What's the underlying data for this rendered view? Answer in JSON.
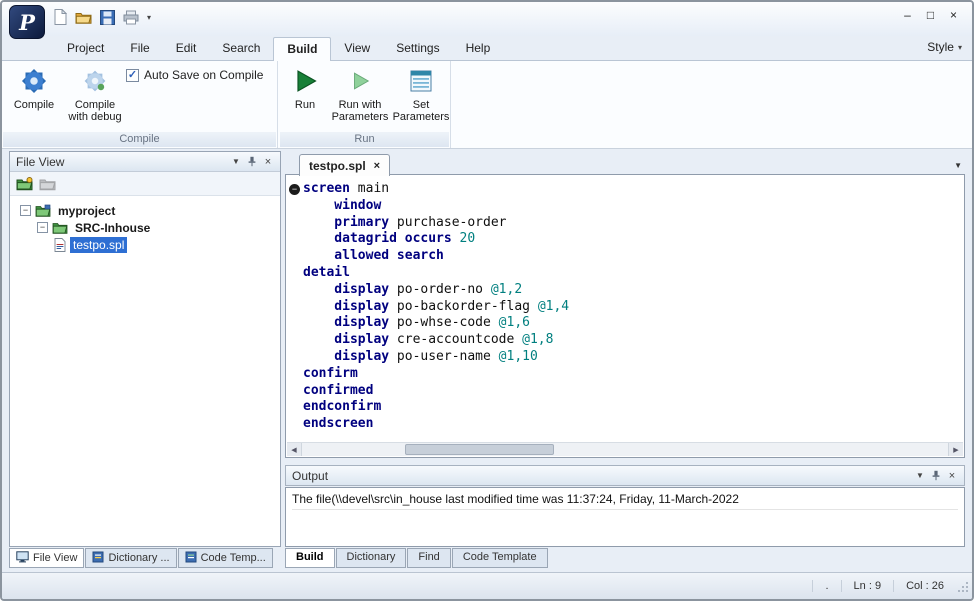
{
  "icons": {
    "chevron_down": "▼",
    "chevron_small": "▾",
    "close": "×",
    "check": "✓",
    "minus": "−",
    "scroll_left": "◀",
    "scroll_right": "▶",
    "logo_letter": "P"
  },
  "titlebar": {
    "window_buttons": {
      "minimize": "–",
      "maximize": "□",
      "close": "×"
    }
  },
  "menu": {
    "tabs": [
      "Project",
      "File",
      "Edit",
      "Search",
      "Build",
      "View",
      "Settings",
      "Help"
    ],
    "active": "Build",
    "style_label": "Style"
  },
  "ribbon": {
    "compile_group": {
      "label": "Compile",
      "auto_save_checkbox": {
        "label": "Auto Save on Compile",
        "checked": true
      },
      "buttons": [
        {
          "label": "Compile"
        },
        {
          "label": "Compile\nwith debug"
        }
      ]
    },
    "run_group": {
      "label": "Run",
      "buttons": [
        {
          "label": "Run"
        },
        {
          "label": "Run with\nParameters"
        },
        {
          "label": "Set\nParameters"
        }
      ]
    }
  },
  "file_view": {
    "title": "File View",
    "tree": [
      {
        "label": "myproject",
        "level": 0,
        "icon": "project",
        "expander": true,
        "bold": true,
        "selected": false
      },
      {
        "label": "SRC-Inhouse",
        "level": 1,
        "icon": "folder",
        "expander": true,
        "bold": true,
        "selected": false
      },
      {
        "label": "testpo.spl",
        "level": 2,
        "icon": "file",
        "expander": false,
        "bold": false,
        "selected": true
      }
    ],
    "tabs": [
      {
        "label": "File View",
        "icon": "screen",
        "active": true
      },
      {
        "label": "Dictionary ...",
        "icon": "dictionary",
        "active": false
      },
      {
        "label": "Code Temp...",
        "icon": "template",
        "active": false
      }
    ]
  },
  "editor": {
    "tab": "testpo.spl",
    "lines": [
      [
        [
          "kw",
          "screen"
        ],
        [
          "pl",
          " main"
        ]
      ],
      [
        [
          "kw",
          "    window"
        ]
      ],
      [
        [
          "kw",
          "    primary"
        ],
        [
          "pl",
          " purchase-order"
        ]
      ],
      [
        [
          "kw",
          "    datagrid occurs"
        ],
        [
          "num",
          " 20"
        ]
      ],
      [
        [
          "kw",
          "    allowed search"
        ]
      ],
      [
        [
          "kw",
          "detail"
        ]
      ],
      [
        [
          "kw",
          "    display"
        ],
        [
          "pl",
          " po-order-no "
        ],
        [
          "num",
          "@1,2"
        ]
      ],
      [
        [
          "kw",
          "    display"
        ],
        [
          "pl",
          " po-backorder-flag "
        ],
        [
          "num",
          "@1,4"
        ]
      ],
      [
        [
          "kw",
          "    display"
        ],
        [
          "pl",
          " po-whse-code "
        ],
        [
          "num",
          "@1,6"
        ]
      ],
      [
        [
          "kw",
          "    display"
        ],
        [
          "pl",
          " cre-accountcode "
        ],
        [
          "num",
          "@1,8"
        ]
      ],
      [
        [
          "kw",
          "    display"
        ],
        [
          "pl",
          " po-user-name "
        ],
        [
          "num",
          "@1,10"
        ]
      ],
      [
        [
          "kw",
          "confirm"
        ]
      ],
      [
        [
          "kw",
          "confirmed"
        ]
      ],
      [
        [
          "kw",
          "endconfirm"
        ]
      ],
      [
        [
          "kw",
          "endscreen"
        ]
      ]
    ]
  },
  "output": {
    "title": "Output",
    "message": "The file(\\\\devel\\src\\in_house last modified time was 11:37:24, Friday, 11-March-2022",
    "tabs": [
      "Build",
      "Dictionary",
      "Find",
      "Code Template"
    ],
    "active_tab": "Build"
  },
  "status": {
    "dot": ".",
    "line": "Ln : 9",
    "col": "Col : 26"
  }
}
